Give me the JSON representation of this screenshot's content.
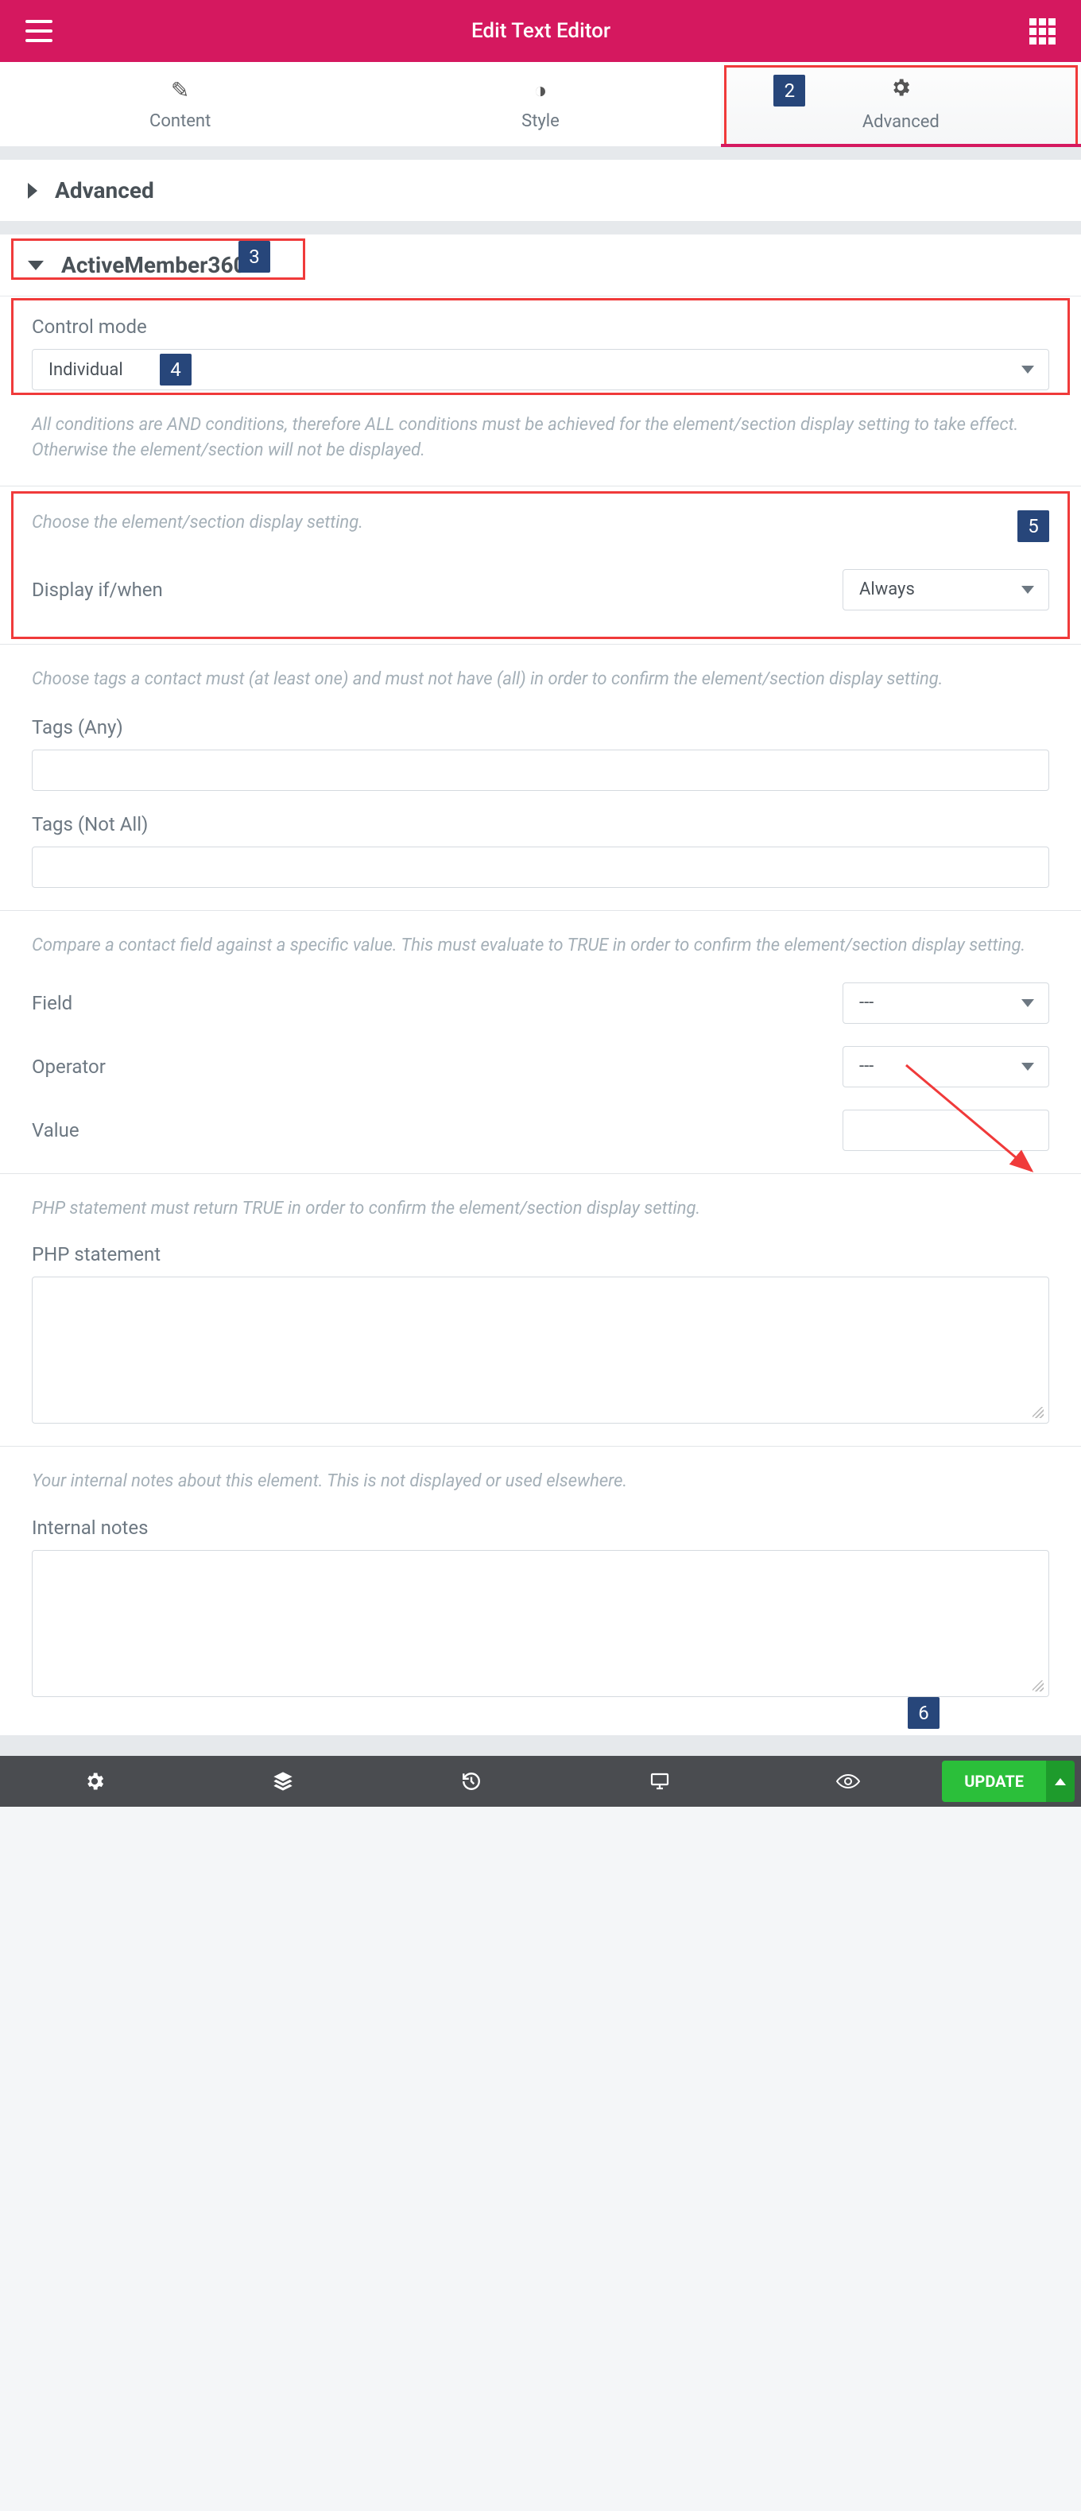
{
  "header": {
    "title": "Edit Text Editor"
  },
  "tabs": {
    "content": "Content",
    "style": "Style",
    "advanced": "Advanced"
  },
  "steps": {
    "s2": "2",
    "s3": "3",
    "s4": "4",
    "s5": "5",
    "s6": "6"
  },
  "accordion": {
    "advanced": "Advanced",
    "am360": "ActiveMember360"
  },
  "controlMode": {
    "label": "Control mode",
    "value": "Individual",
    "note": "All conditions are AND conditions, therefore ALL conditions must be achieved for the element/section display setting to take effect. Otherwise the element/section will not be displayed."
  },
  "display": {
    "desc": "Choose the element/section display setting.",
    "label": "Display if/when",
    "value": "Always"
  },
  "tags": {
    "desc": "Choose tags a contact must (at least one) and must not have (all) in order to confirm the element/section display setting.",
    "anyLabel": "Tags (Any)",
    "notAllLabel": "Tags (Not All)"
  },
  "fieldCompare": {
    "desc": "Compare a contact field against a specific value. This must evaluate to TRUE in order to confirm the element/section display setting.",
    "fieldLabel": "Field",
    "fieldValue": "---",
    "operatorLabel": "Operator",
    "operatorValue": "---",
    "valueLabel": "Value"
  },
  "php": {
    "desc": "PHP statement must return TRUE in order to confirm the element/section display setting.",
    "label": "PHP statement"
  },
  "notes": {
    "desc": "Your internal notes about this element. This is not displayed or used elsewhere.",
    "label": "Internal notes"
  },
  "footer": {
    "update": "Update"
  }
}
